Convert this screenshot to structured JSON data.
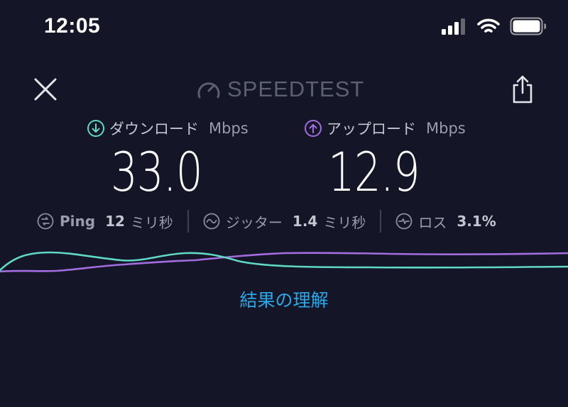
{
  "status_bar": {
    "time": "12:05"
  },
  "header": {
    "brand": "SPEEDTEST"
  },
  "download": {
    "label": "ダウンロード",
    "unit": "Mbps",
    "value": "33.0",
    "color": "#5fd8c4"
  },
  "upload": {
    "label": "アップロード",
    "unit": "Mbps",
    "value": "12.9",
    "color": "#a36de0"
  },
  "stats": {
    "ping": {
      "label": "Ping",
      "value": "12",
      "unit": "ミリ秒"
    },
    "jitter": {
      "label": "ジッター",
      "value": "1.4",
      "unit": "ミリ秒"
    },
    "loss": {
      "label": "ロス",
      "value": "3.1%"
    }
  },
  "results_link": "結果の理解"
}
